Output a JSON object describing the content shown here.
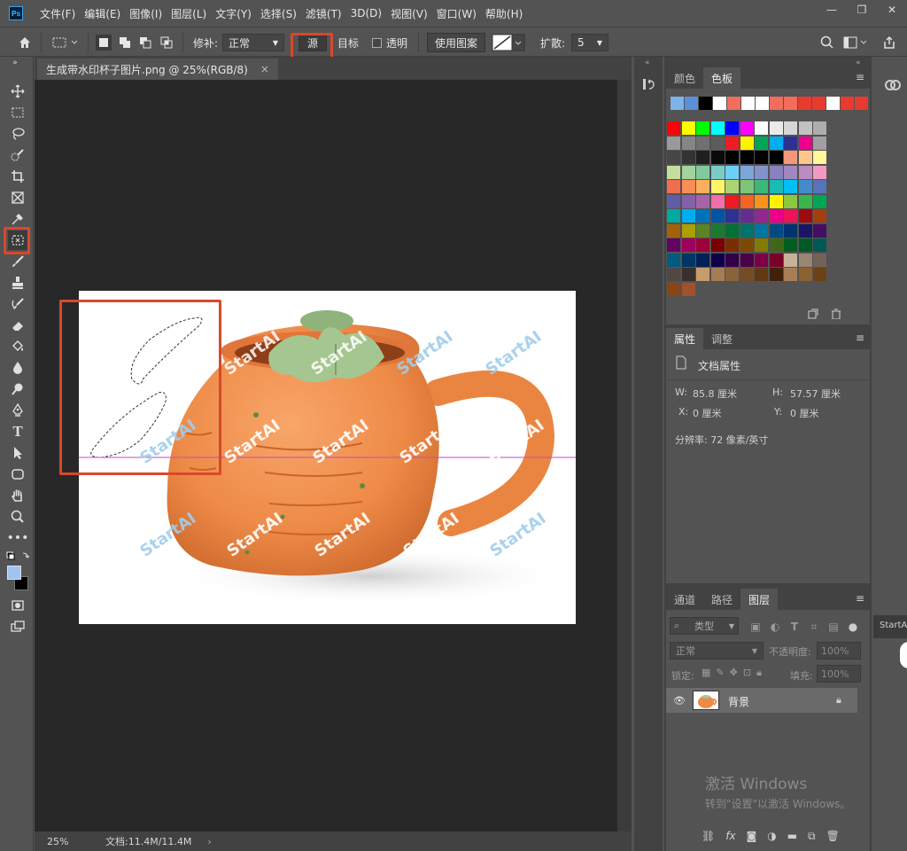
{
  "app": {
    "logo": "Ps"
  },
  "menu": [
    "文件(F)",
    "编辑(E)",
    "图像(I)",
    "图层(L)",
    "文字(Y)",
    "选择(S)",
    "滤镜(T)",
    "3D(D)",
    "视图(V)",
    "窗口(W)",
    "帮助(H)"
  ],
  "window_controls": {
    "minimize": "—",
    "restore": "❐",
    "close": "✕"
  },
  "options": {
    "patch_label": "修补:",
    "patch_mode": "正常",
    "source_label": "源",
    "target_label": "目标",
    "transparent_label": "透明",
    "use_pattern_label": "使用图案",
    "diffusion_label": "扩散:",
    "diffusion_value": "5"
  },
  "document": {
    "tab_title": "生成带水印杯子图片.png @ 25%(RGB/8)",
    "tab_close": "×",
    "zoom": "25%",
    "doc_size": "文档:11.4M/11.4M",
    "watermark_text": "StartAI"
  },
  "panels": {
    "swatches": {
      "tabs": [
        "颜色",
        "色板"
      ],
      "active_tab": "色板",
      "recent": [
        "#7fb3e8",
        "#5b8fd9",
        "#000000",
        "#ffffff",
        "#f26d5b",
        "#ffffff",
        "#ffffff",
        "#f26d5b",
        "#f26d5b",
        "#e83a2e",
        "#e83a2e",
        "#ffffff",
        "#e83a2e",
        "#e83a2e"
      ],
      "grid": [
        [
          "#ff0000",
          "#ffff00",
          "#00ff00",
          "#00ffff",
          "#0000ff",
          "#ff00ff",
          "#ffffff",
          "#ebebeb",
          "#d6d6d6",
          "#c2c2c2",
          "#adadad"
        ],
        [
          "#999999",
          "#858585",
          "#707070",
          "#5c5c5c",
          "#ed1c24",
          "#fff200",
          "#00a651",
          "#00aeef",
          "#2e3192",
          "#ec008c",
          "#a0a0a0"
        ],
        [
          "#474747",
          "#333333",
          "#1f1f1f",
          "#0a0a0a",
          "#000000",
          "#000000",
          "#000000",
          "#000000",
          "#f7977a",
          "#fdc68a",
          "#fff79a"
        ],
        [
          "#c4df9b",
          "#a3d39c",
          "#82ca9c",
          "#7accc8",
          "#6dcff6",
          "#7da7d9",
          "#8393ca",
          "#8781bd",
          "#a187be",
          "#bd8cbf",
          "#f49ac1"
        ],
        [
          "#f26c4f",
          "#f68e55",
          "#fbaf5c",
          "#fff467",
          "#acd372",
          "#7cc576",
          "#3bb878",
          "#1abbb4",
          "#00bff3",
          "#438ccb",
          "#5574b9"
        ],
        [
          "#605ca8",
          "#855fa8",
          "#a763a8",
          "#f06eaa",
          "#ed1c24",
          "#f26522",
          "#f7941d",
          "#fff200",
          "#8dc73f",
          "#39b54a",
          "#00a651"
        ],
        [
          "#00a99d",
          "#00aeef",
          "#0072bc",
          "#0054a6",
          "#2e3192",
          "#662d91",
          "#92278f",
          "#ec008c",
          "#ed145b",
          "#9e0b0f",
          "#a0410d"
        ],
        [
          "#a36209",
          "#aba000",
          "#598527",
          "#1a7b30",
          "#007236",
          "#00746b",
          "#0076a3",
          "#004b80",
          "#003471",
          "#1b1464",
          "#440e62"
        ],
        [
          "#630460",
          "#9e005d",
          "#9e0039",
          "#790000",
          "#7b2e00",
          "#7d4900",
          "#827b00",
          "#406618",
          "#005e20",
          "#005826",
          "#005952"
        ],
        [
          "#005b7f",
          "#003663",
          "#002157",
          "#0d004c",
          "#32004b",
          "#4b0049",
          "#7b0046",
          "#7a0026",
          "#c7b299",
          "#998675",
          "#736357"
        ],
        [
          "#534741",
          "#37302d",
          "#c69c6d",
          "#a67c52",
          "#8c6239",
          "#754c24",
          "#603913",
          "#42210b",
          "#a97e54",
          "#8c6132",
          "#6b4216"
        ]
      ],
      "last_row": [
        "#8b4513",
        "#a0522d"
      ]
    },
    "properties": {
      "tabs": [
        "属性",
        "调整"
      ],
      "active_tab": "属性",
      "header": "文档属性",
      "w_label": "W:",
      "w_value": "85.8 厘米",
      "h_label": "H:",
      "h_value": "57.57 厘米",
      "x_label": "X:",
      "x_value": "0 厘米",
      "y_label": "Y:",
      "y_value": "0 厘米",
      "resolution": "分辨率: 72 像素/英寸"
    },
    "layers": {
      "tabs": [
        "通道",
        "路径",
        "图层"
      ],
      "active_tab": "图层",
      "filter_kind": "类型",
      "blend_mode": "正常",
      "opacity_label": "不透明度:",
      "opacity_value": "100%",
      "lock_label": "锁定:",
      "fill_label": "填充:",
      "fill_value": "100%",
      "layer_name": "背景",
      "tooltip": "StartAI"
    }
  },
  "activation": {
    "title": "激活 Windows",
    "subtitle": "转到\"设置\"以激活 Windows。"
  }
}
